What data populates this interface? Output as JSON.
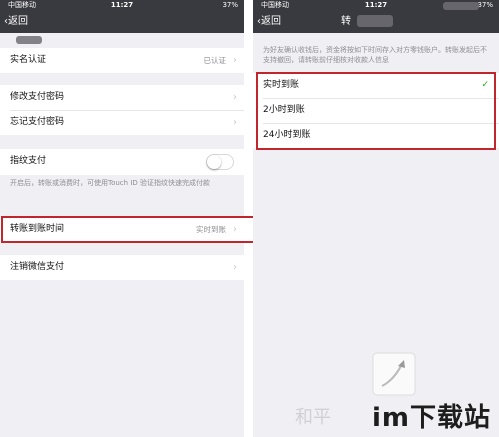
{
  "left": {
    "status": {
      "carrier": "中国移动",
      "time": "11:27",
      "battery": "37%"
    },
    "nav": {
      "back": "返回"
    },
    "rows": {
      "realname": {
        "label": "实名认证",
        "value": "已认证"
      },
      "change_pwd": {
        "label": "修改支付密码"
      },
      "forgot_pwd": {
        "label": "忘记支付密码"
      },
      "fingerprint": {
        "label": "指纹支付",
        "enabled": false,
        "hint": "开启后，转账或消费时，可使用Touch ID 验证指纹快速完成付款"
      },
      "transfer_time": {
        "label": "转账到账时间",
        "value": "实时到账"
      },
      "cancel": {
        "label": "注销微信支付"
      }
    }
  },
  "right": {
    "status": {
      "carrier": "中国移动",
      "time": "11:27",
      "battery": "37%"
    },
    "nav": {
      "back": "返回",
      "title_partial": "转"
    },
    "hint": "为好友确认收钱后，资金将按如下时间存入对方零钱账户。转账发起后不支持撤回，请转账前仔细核对收款人信息",
    "options": [
      {
        "label": "实时到账",
        "selected": true
      },
      {
        "label": "2小时到账",
        "selected": false
      },
      {
        "label": "24小时到账",
        "selected": false
      }
    ]
  },
  "watermark": {
    "text": "im下载站",
    "faint": "和平"
  },
  "colors": {
    "highlight": "#c0272d",
    "navbar": "#393a3f",
    "background": "#efeff4"
  }
}
